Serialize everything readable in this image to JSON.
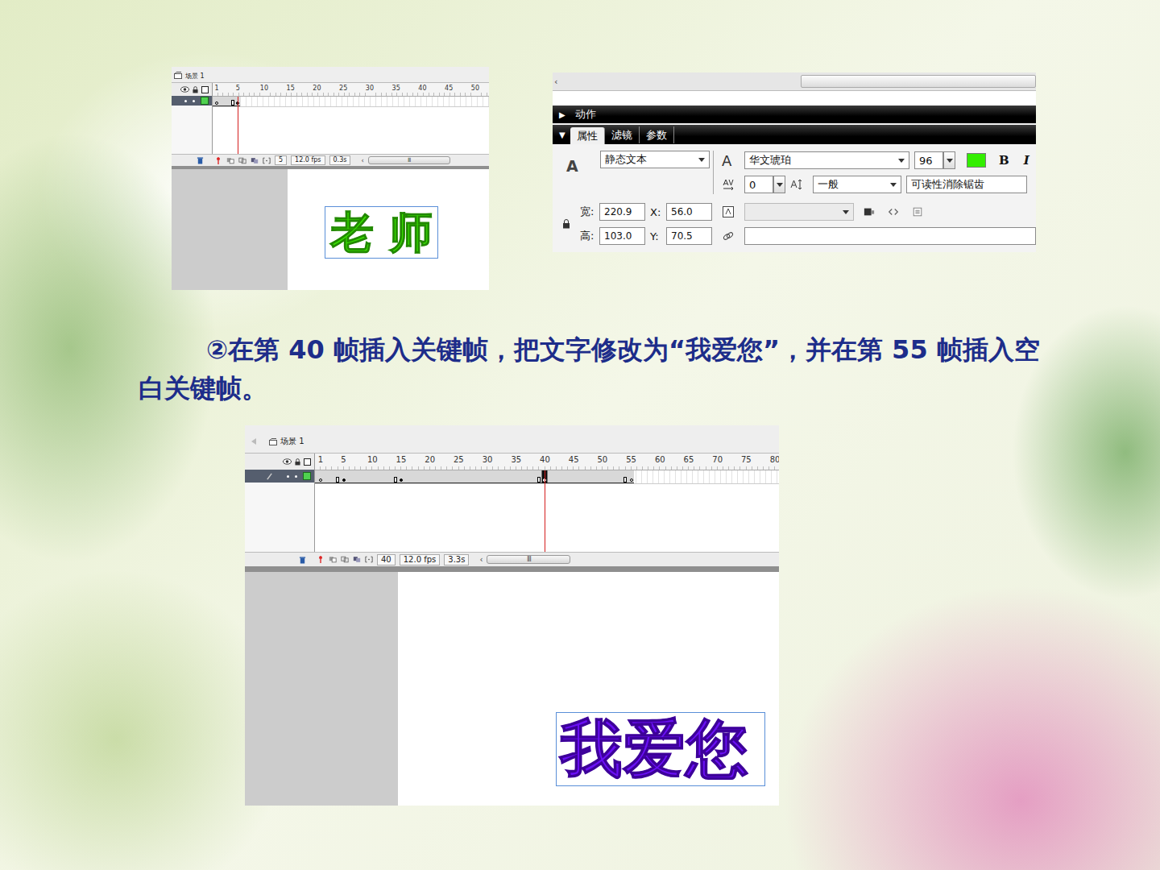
{
  "top_timeline": {
    "scene": "场景 1",
    "ticks": [
      "1",
      "5",
      "10",
      "15",
      "20",
      "25",
      "30",
      "35",
      "40",
      "45",
      "50"
    ],
    "current_frame": "5",
    "fps": "12.0 fps",
    "elapsed": "0.3s",
    "scroll_left": "‹",
    "scroll_grip": "III",
    "keyframes": [
      {
        "frame": 1,
        "kind": "empty"
      },
      {
        "frame": 5,
        "kind": "filled"
      }
    ],
    "stage_text": "老 师"
  },
  "properties": {
    "scroll_left": "‹",
    "actions": {
      "arrow": "▶",
      "label": "动作",
      "expanded": false
    },
    "tabs_arrow": "▼",
    "tabs": [
      {
        "label": "属性",
        "selected": true
      },
      {
        "label": "滤镜",
        "selected": false
      },
      {
        "label": "参数",
        "selected": false
      }
    ],
    "type_icon": "A",
    "text_type": "静态文本",
    "font_icon": "A",
    "font": "华文琥珀",
    "size": "96",
    "text_color": "#33ee00",
    "bold": "B",
    "italic": "I",
    "letter_spacing": "0",
    "kerning": "一般",
    "antialias": "可读性消除锯齿",
    "width_label": "宽:",
    "width": "220.9",
    "x_label": "X:",
    "x": "56.0",
    "height_label": "高:",
    "height": "103.0",
    "y_label": "Y:",
    "y": "70.5"
  },
  "caption": "②在第 40 帧插入关键帧，把文字修改为“我爱您”，并在第 55 帧插入空白关键帧。",
  "bottom_timeline": {
    "scene": "场景 1",
    "ticks": [
      "1",
      "5",
      "10",
      "15",
      "20",
      "25",
      "30",
      "35",
      "40",
      "45",
      "50",
      "55",
      "60",
      "65",
      "70",
      "75",
      "80"
    ],
    "current_frame": "40",
    "fps": "12.0 fps",
    "elapsed": "3.3s",
    "scroll_left": "‹",
    "scroll_grip": "III",
    "keyframes": [
      {
        "frame": 1,
        "kind": "empty"
      },
      {
        "frame": 5,
        "kind": "filled"
      },
      {
        "frame": 15,
        "kind": "filled"
      },
      {
        "frame": 40,
        "kind": "filled"
      },
      {
        "frame": 55,
        "kind": "empty"
      }
    ],
    "stage_text": "我爱您"
  }
}
